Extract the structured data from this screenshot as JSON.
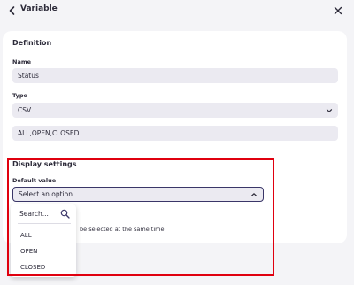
{
  "header": {
    "title": "Variable"
  },
  "definition": {
    "section_title": "Definition",
    "name_label": "Name",
    "name_value": "Status",
    "type_label": "Type",
    "type_value": "CSV",
    "values_text": "ALL,OPEN,CLOSED"
  },
  "display": {
    "section_title": "Display settings",
    "default_label": "Default value",
    "select_placeholder": "Select an option",
    "hint_text": "be selected at the same time"
  },
  "dropdown": {
    "search_placeholder": "Search...",
    "options": [
      "ALL",
      "OPEN",
      "CLOSED"
    ]
  },
  "colors": {
    "highlight": "#e0000f",
    "field_bg": "#ebeaf1",
    "accent": "#3a3668"
  },
  "icons": [
    "chevron-left-icon",
    "close-icon",
    "chevron-down-icon",
    "chevron-up-icon",
    "search-icon"
  ]
}
